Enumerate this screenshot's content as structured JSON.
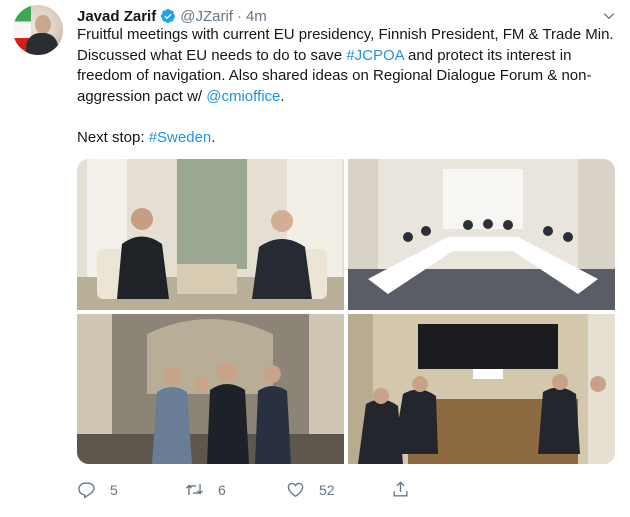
{
  "tweet": {
    "author_name": "Javad Zarif",
    "author_handle": "@JZarif",
    "separator": "·",
    "time": "4m",
    "text_part1": "Fruitful meetings with current EU presidency, Finnish President, FM & Trade Min. Discussed what EU needs to do to save ",
    "hashtag_jcpoa": "#JCPOA",
    "text_part2": " and protect its interest in freedom of navigation. Also shared ideas on Regional Dialogue Forum & non-aggression pact w/ ",
    "mention": "@cmioffice",
    "text_part3": ".",
    "next_stop_prefix": "Next stop: ",
    "hashtag_sweden": "#Sweden",
    "next_stop_suffix": ".",
    "photos": [
      "two-men-seated-conversation",
      "delegation-meeting-table",
      "group-walking-hallway",
      "conference-room-meeting"
    ]
  },
  "actions": {
    "reply_count": "5",
    "retweet_count": "6",
    "like_count": "52"
  },
  "colors": {
    "link": "#1b95e0",
    "muted": "#657786",
    "text": "#14171a",
    "verified": "#1da1f2"
  },
  "icons": [
    "verified-badge-icon",
    "caret-down-icon",
    "reply-icon",
    "retweet-icon",
    "like-icon",
    "share-icon"
  ]
}
